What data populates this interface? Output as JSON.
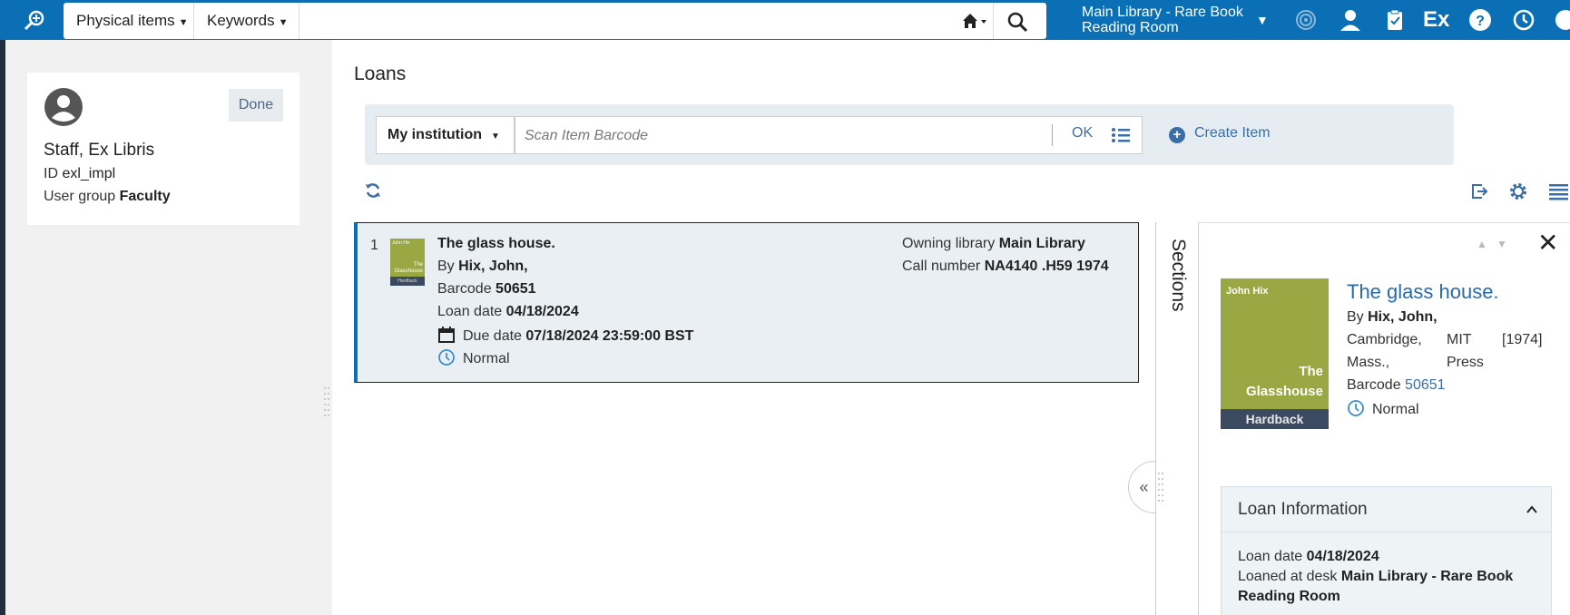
{
  "topbar": {
    "search_type": "Physical items",
    "search_field": "Keywords",
    "location_line1": "Main Library - Rare Book",
    "location_line2": "Reading Room"
  },
  "user": {
    "done_label": "Done",
    "name": "Staff, Ex Libris",
    "id_label": "ID",
    "id_value": "exl_impl",
    "group_label": "User group",
    "group_value": "Faculty"
  },
  "main": {
    "title": "Loans",
    "institution": "My institution",
    "scan_placeholder": "Scan Item Barcode",
    "ok_label": "OK",
    "create_item_label": "Create Item"
  },
  "loan_item": {
    "index": "1",
    "thumb_author": "John Hix",
    "thumb_title_1": "The",
    "thumb_title_2": "Glasshouse",
    "thumb_band": "Hardback",
    "title": "The glass house.",
    "by_label": "By",
    "author": "Hix, John,",
    "barcode_label": "Barcode",
    "barcode": "50651",
    "loan_date_label": "Loan date",
    "loan_date": "04/18/2024",
    "due_date_label": "Due date",
    "due_date": "07/18/2024 23:59:00 BST",
    "policy": "Normal",
    "owning_library_label": "Owning library",
    "owning_library": "Main Library",
    "call_number_label": "Call number",
    "call_number": "NA4140 .H59 1974"
  },
  "sections_label": "Sections",
  "detail": {
    "cover_author": "John Hix",
    "cover_title_1": "The",
    "cover_title_2": "Glasshouse",
    "cover_band": "Hardback",
    "title": "The glass house.",
    "by_label": "By",
    "author": "Hix, John,",
    "place_1": "Cambridge,",
    "place_2": "Mass.,",
    "publisher_1": "MIT",
    "publisher_2": "Press",
    "year": "[1974]",
    "barcode_label": "Barcode",
    "barcode": "50651",
    "policy": "Normal",
    "loan_info_title": "Loan Information",
    "loan_date_label": "Loan date",
    "loan_date": "04/18/2024",
    "loaned_at_label": "Loaned at desk",
    "loaned_at_1": "Main Library - Rare Book",
    "loaned_at_2": "Reading Room"
  },
  "icons": [
    "app-search-icon",
    "home-icon",
    "search-icon",
    "radar-icon",
    "user-icon",
    "clipboard-icon",
    "ex-icon",
    "help-icon",
    "history-icon",
    "chat-icon",
    "refresh-icon",
    "export-icon",
    "gear-icon",
    "list-view-icon",
    "calendar-icon",
    "clock-icon",
    "close-icon",
    "chevron-up-icon"
  ],
  "colors": {
    "topbar": "#0a6fb5",
    "accent": "#3b6ea5",
    "cover": "#99a842"
  }
}
